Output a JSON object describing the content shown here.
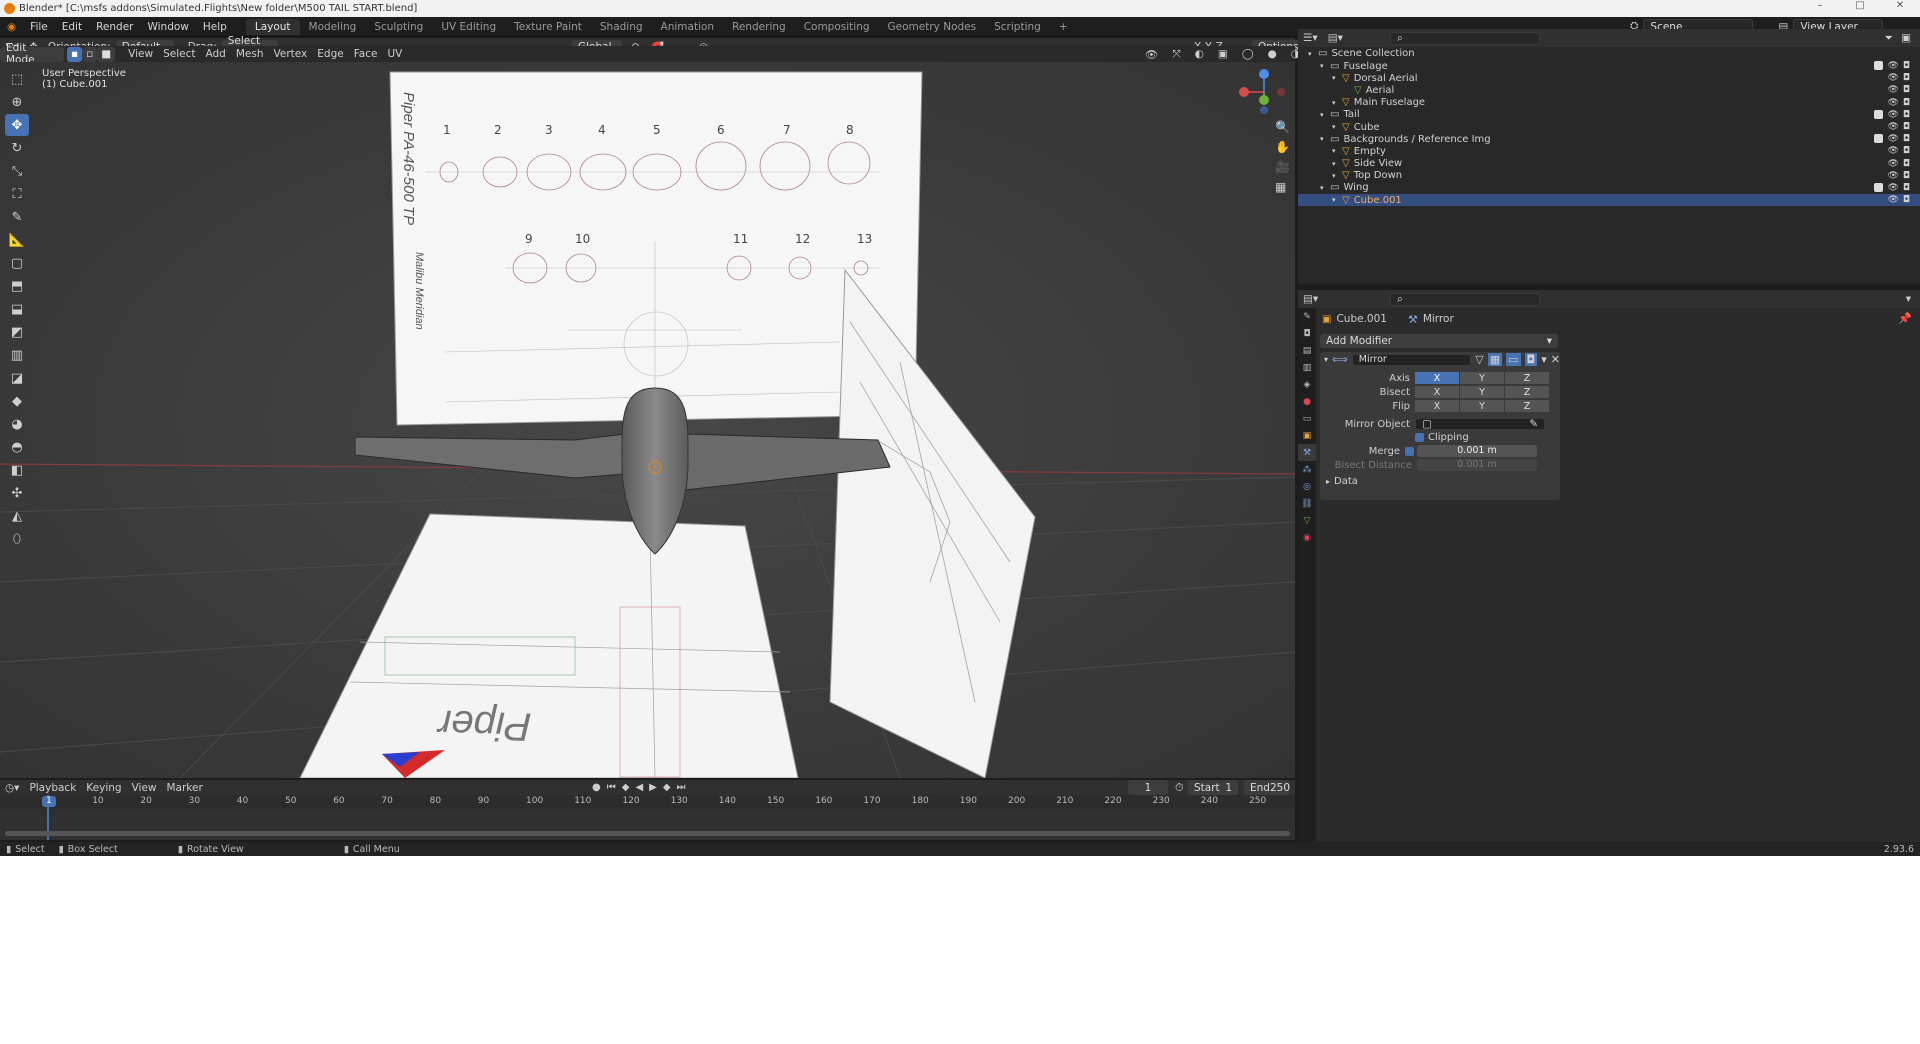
{
  "window": {
    "title": "Blender* [C:\\msfs addons\\Simulated.Flights\\New folder\\M500 TAIL START.blend]",
    "controls": [
      "–",
      "□",
      "✕"
    ]
  },
  "menu": [
    "File",
    "Edit",
    "Render",
    "Window",
    "Help"
  ],
  "workspaces": [
    "Layout",
    "Modeling",
    "Sculpting",
    "UV Editing",
    "Texture Paint",
    "Shading",
    "Animation",
    "Rendering",
    "Compositing",
    "Geometry Nodes",
    "Scripting"
  ],
  "active_workspace": "Layout",
  "scene": {
    "name": "Scene",
    "view_layer": "View Layer"
  },
  "viewport_header": {
    "orientation_label": "Orientation:",
    "orientation_value": "Default",
    "drag_label": "Drag:",
    "drag_value": "Select Box",
    "transform_orientation": "Global",
    "axes": [
      "X",
      "Y",
      "Z"
    ],
    "options": "Options",
    "mode": "Edit Mode",
    "menus": [
      "View",
      "Select",
      "Add",
      "Mesh",
      "Vertex",
      "Edge",
      "Face",
      "UV"
    ]
  },
  "viewport_info": {
    "perspective": "User Perspective",
    "object": "(1) Cube.001"
  },
  "blueprint": {
    "title": "Piper PA-46-500 TP",
    "subtitle": "Malibu Meridian",
    "section_numbers_row1": [
      "1",
      "2",
      "3",
      "4",
      "5",
      "6",
      "7",
      "8"
    ],
    "section_numbers_row2": [
      "9",
      "10",
      "11",
      "12",
      "13"
    ],
    "logo_text": "Piper"
  },
  "outliner": {
    "items": [
      {
        "label": "Scene Collection",
        "indent": 0,
        "kind": "collection",
        "selected": false
      },
      {
        "label": "Fuselage",
        "indent": 1,
        "kind": "collection",
        "selected": false
      },
      {
        "label": "Dorsal Aerial",
        "indent": 2,
        "kind": "object",
        "selected": false
      },
      {
        "label": "Aerial",
        "indent": 3,
        "kind": "mesh",
        "selected": false
      },
      {
        "label": "Main Fuselage",
        "indent": 2,
        "kind": "object",
        "selected": false
      },
      {
        "label": "Tail",
        "indent": 1,
        "kind": "collection",
        "selected": false
      },
      {
        "label": "Cube",
        "indent": 2,
        "kind": "object",
        "selected": false
      },
      {
        "label": "Backgrounds / Reference Img",
        "indent": 1,
        "kind": "collection",
        "selected": false
      },
      {
        "label": "Empty",
        "indent": 2,
        "kind": "object",
        "selected": false
      },
      {
        "label": "Side View",
        "indent": 2,
        "kind": "object",
        "selected": false
      },
      {
        "label": "Top Down",
        "indent": 2,
        "kind": "object",
        "selected": false
      },
      {
        "label": "Wing",
        "indent": 1,
        "kind": "collection",
        "selected": false
      },
      {
        "label": "Cube.001",
        "indent": 2,
        "kind": "object",
        "selected": true
      }
    ]
  },
  "properties": {
    "object_name": "Cube.001",
    "modifier_breadcrumb": "Mirror",
    "add_modifier": "Add Modifier",
    "modifier_name": "Mirror",
    "axis_label": "Axis",
    "bisect_label": "Bisect",
    "flip_label": "Flip",
    "axis_buttons": [
      "X",
      "Y",
      "Z"
    ],
    "axis_state": {
      "axis": [
        true,
        false,
        false
      ],
      "bisect": [
        false,
        false,
        false
      ],
      "flip": [
        false,
        false,
        false
      ]
    },
    "mirror_object_label": "Mirror Object",
    "clipping_label": "Clipping",
    "merge_label": "Merge",
    "merge_value": "0.001 m",
    "bisect_distance_label": "Bisect Distance",
    "bisect_distance_value": "0.001 m",
    "data_label": "Data"
  },
  "timeline": {
    "menus": [
      "Playback",
      "Keying",
      "View",
      "Marker"
    ],
    "current_frame": "1",
    "start_label": "Start",
    "start_value": "1",
    "end_label": "End",
    "end_value": "250",
    "ticks": [
      "0",
      "10",
      "20",
      "30",
      "40",
      "50",
      "60",
      "70",
      "80",
      "90",
      "100",
      "110",
      "120",
      "130",
      "140",
      "150",
      "160",
      "170",
      "180",
      "190",
      "200",
      "210",
      "220",
      "230",
      "240",
      "250"
    ]
  },
  "statusbar": {
    "select": "Select",
    "box_select": "Box Select",
    "rotate_view": "Rotate View",
    "call_menu": "Call Menu",
    "version": "2.93.6"
  }
}
